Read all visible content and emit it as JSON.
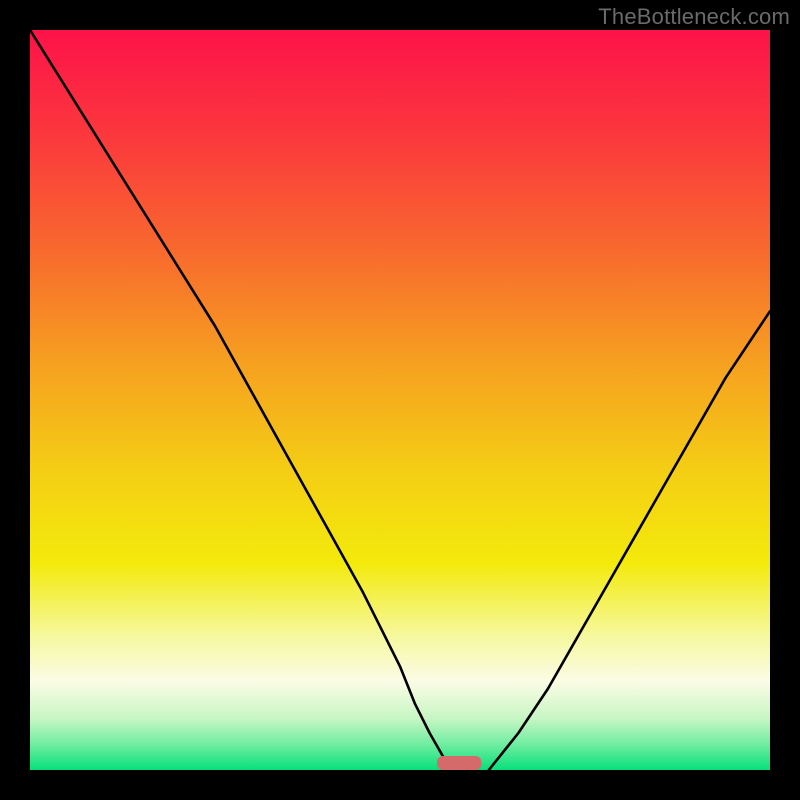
{
  "watermark": "TheBottleneck.com",
  "chart_data": {
    "type": "line",
    "title": "",
    "xlabel": "",
    "ylabel": "",
    "xlim": [
      0,
      100
    ],
    "ylim": [
      0,
      100
    ],
    "gradient_stops": [
      {
        "offset": 0.0,
        "color": "#fd1249"
      },
      {
        "offset": 0.15,
        "color": "#fb3a3c"
      },
      {
        "offset": 0.3,
        "color": "#f86a2e"
      },
      {
        "offset": 0.45,
        "color": "#f6a020"
      },
      {
        "offset": 0.6,
        "color": "#f4cf14"
      },
      {
        "offset": 0.72,
        "color": "#f3ea0b"
      },
      {
        "offset": 0.82,
        "color": "#f6f8a0"
      },
      {
        "offset": 0.88,
        "color": "#fbfce5"
      },
      {
        "offset": 0.93,
        "color": "#c8f6c5"
      },
      {
        "offset": 0.965,
        "color": "#71eda0"
      },
      {
        "offset": 1.0,
        "color": "#07e07c"
      }
    ],
    "valley_marker": {
      "x": 58,
      "width": 6,
      "color": "#d46a6a"
    },
    "series": [
      {
        "name": "bottleneck-curve-left",
        "x": [
          0,
          5,
          10,
          15,
          20,
          25,
          30,
          35,
          40,
          45,
          50,
          52,
          54,
          56,
          58
        ],
        "values": [
          100,
          92,
          84,
          76,
          68,
          60,
          51,
          42,
          33,
          24,
          14,
          9,
          5,
          1.5,
          0
        ]
      },
      {
        "name": "bottleneck-curve-right",
        "x": [
          62,
          66,
          70,
          74,
          78,
          82,
          86,
          90,
          94,
          98,
          100
        ],
        "values": [
          0,
          5,
          11,
          18,
          25,
          32,
          39,
          46,
          53,
          59,
          62
        ]
      }
    ]
  }
}
